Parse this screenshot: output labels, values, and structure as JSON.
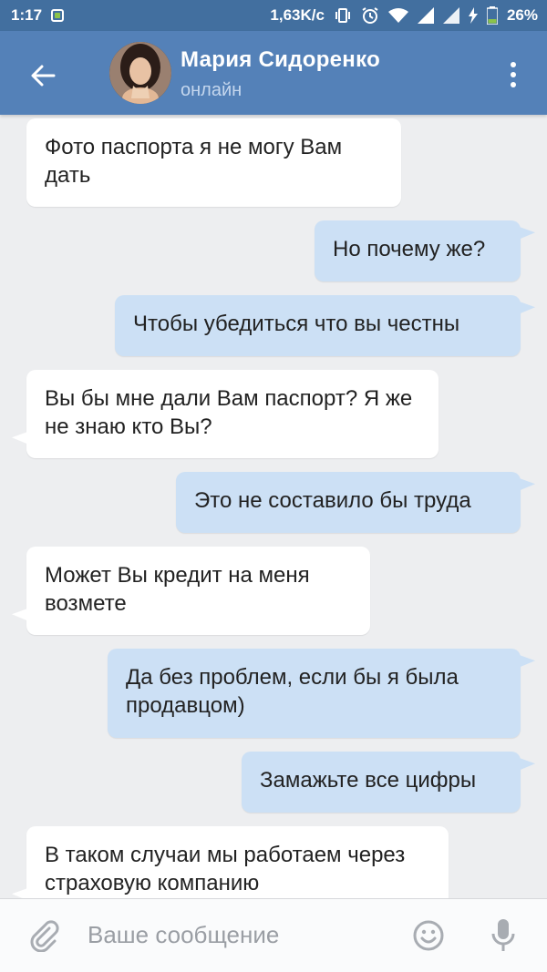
{
  "status_bar": {
    "time": "1:17",
    "network_speed": "1,63K/c",
    "battery": "26%"
  },
  "header": {
    "contact_name": "Мария Сидоренко",
    "contact_status": "онлайн",
    "accent_color": "#5481b8"
  },
  "messages": [
    {
      "direction": "in",
      "text": "Фото паспорта я не могу Вам дать"
    },
    {
      "direction": "out",
      "text": "Но почему же?"
    },
    {
      "direction": "out",
      "text": "Чтобы убедиться что вы честны"
    },
    {
      "direction": "in",
      "text": "Вы бы мне дали Вам паспорт? Я же не знаю кто Вы?"
    },
    {
      "direction": "out",
      "text": "Это не составило бы труда"
    },
    {
      "direction": "in",
      "text": "Может Вы кредит на меня возмете"
    },
    {
      "direction": "out",
      "text": "Да без проблем, если бы я была продавцом)"
    },
    {
      "direction": "out",
      "text": "Замажьте все цифры"
    },
    {
      "direction": "in",
      "text": "В таком случаи мы работаем через страховую компанию"
    }
  ],
  "composer": {
    "placeholder": "Ваше сообщение"
  },
  "icons": {
    "back": "arrow-left-icon",
    "menu": "more-vertical-icon",
    "attach": "paperclip-icon",
    "emoji": "smiley-icon",
    "mic": "microphone-icon"
  }
}
